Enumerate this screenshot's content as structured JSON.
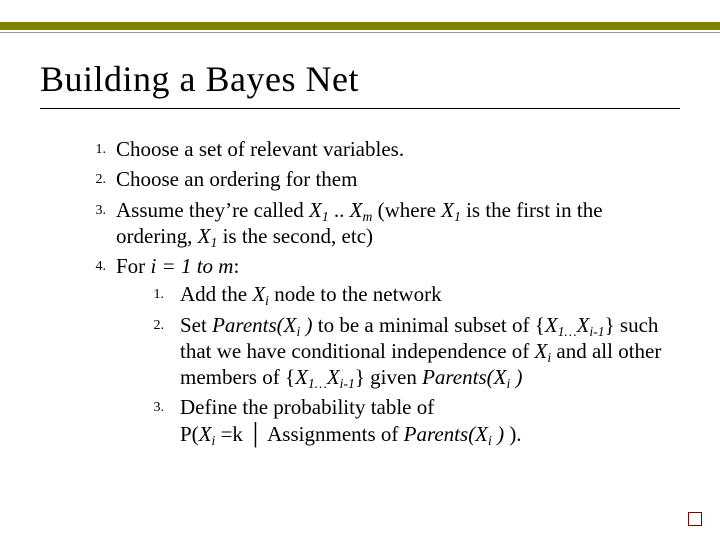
{
  "title": "Building a Bayes Net",
  "items": {
    "n1": "1.",
    "t1": "Choose a set of relevant variables.",
    "n2": "2.",
    "t2": "Choose an ordering for them",
    "n3": "3.",
    "t3a": "Assume they’re called ",
    "t3b": "X",
    "t3c": " .. ",
    "t3d": "X",
    "t3e": " (where ",
    "t3f": "X",
    "t3g": " is the first in the ordering, ",
    "t3h": "X",
    "t3i": " is the second, etc)",
    "n4": "4.",
    "t4a": "For ",
    "t4b": "i = 1 to m",
    "t4c": ":",
    "i1n": "1.",
    "i1a": "Add the ",
    "i1b": "X",
    "i1c": " node to the network",
    "i2n": "2.",
    "i2a": "Set ",
    "i2b": "Parents(X",
    "i2c": " )",
    "i2d": " to be a minimal subset of {",
    "i2e": "X",
    "i2f": "X",
    "i2g": "} such that we have conditional independence of ",
    "i2h": "X",
    "i2i": " and all other members of {",
    "i2j": "X",
    "i2k": "X",
    "i2l": "} given ",
    "i2m": "Parents(X",
    "i2n2": " )",
    "i3n": "3.",
    "i3a": "Define the probability table of",
    "i3b": "P(",
    "i3c": "X",
    "i3d": " =k ",
    "i3e": "│",
    "i3f": " Assignments of ",
    "i3g": "Parents(X",
    "i3h": " )",
    "i3i": " ).",
    "sub_1a": "1",
    "sub_m": "m",
    "sub_1b": "1",
    "sub_1c": "1",
    "sub_i": "i",
    "sub_1d": "1…",
    "sub_im1a": "i-1",
    "sub_ie": "i",
    "sub_1e": "1…",
    "sub_im1b": "i-1",
    "sub_if": "i",
    "sub_ig": "i",
    "sub_ih": "i"
  }
}
